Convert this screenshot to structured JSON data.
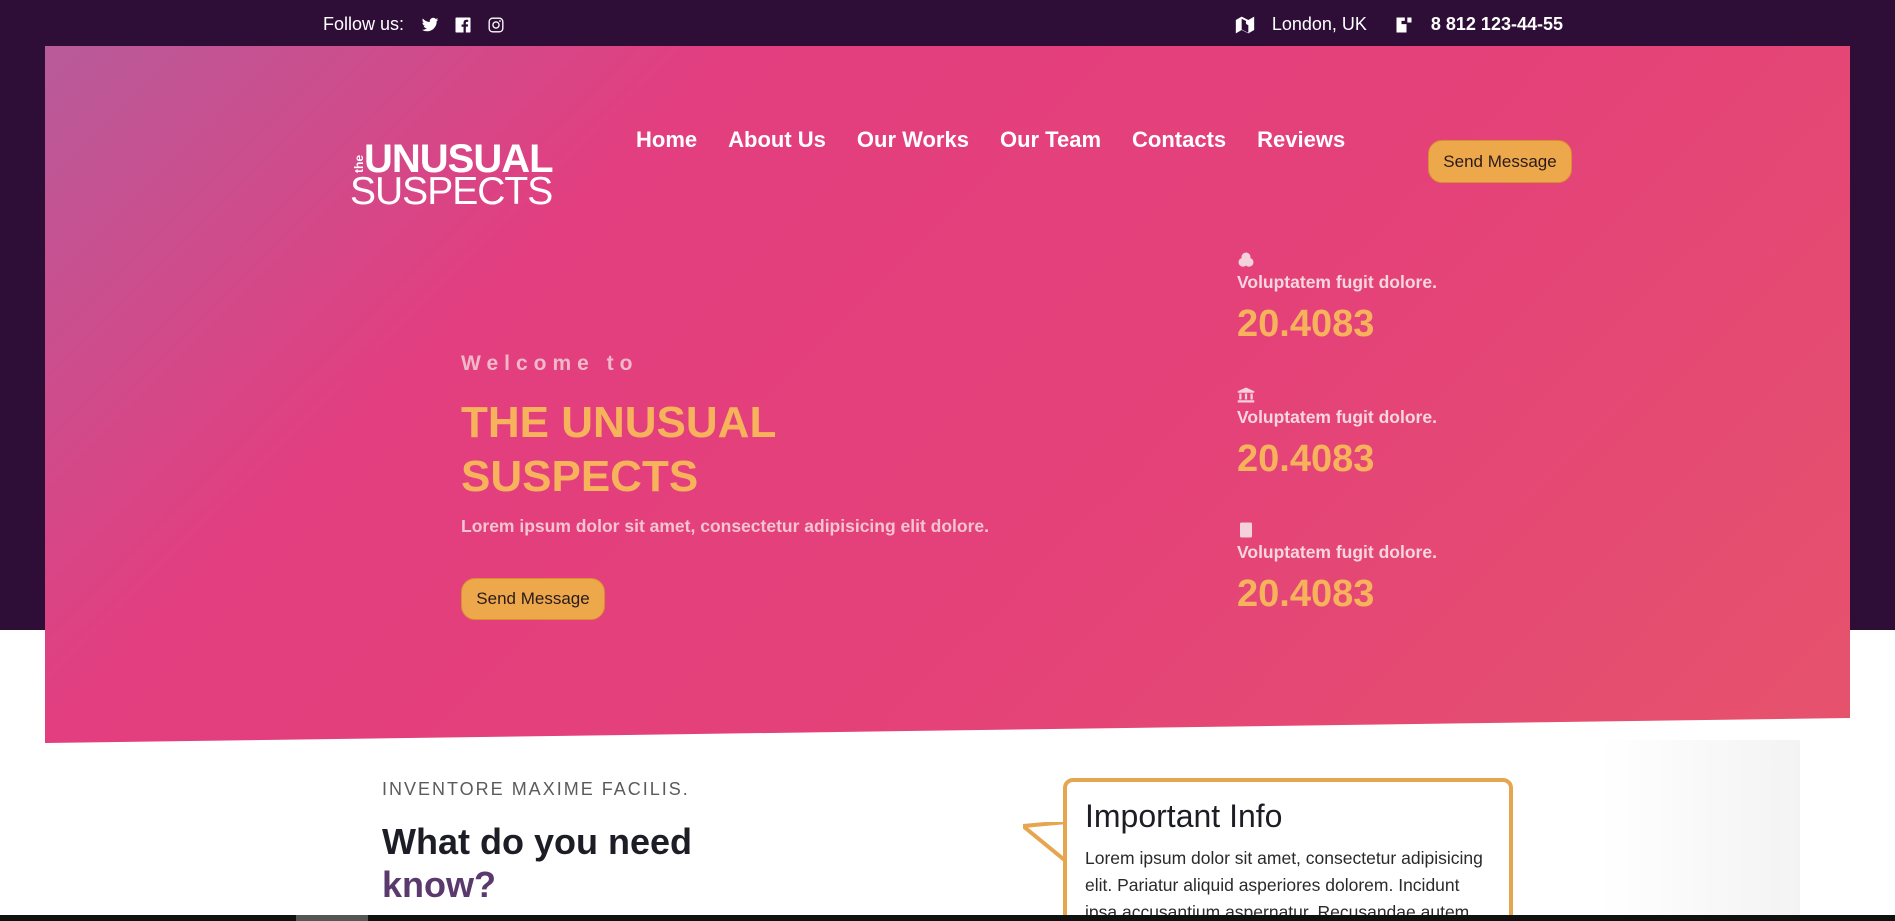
{
  "topbar": {
    "follow_label": "Follow us:",
    "social": [
      "twitter-icon",
      "facebook-icon",
      "instagram-icon"
    ],
    "location": "London, UK",
    "phone": "8 812 123-44-55"
  },
  "logo": {
    "the": "the",
    "line1": "UNUSUAL",
    "line2": "SUSPECTS"
  },
  "nav": {
    "items": [
      {
        "label": "Home"
      },
      {
        "label": "About Us"
      },
      {
        "label": "Our Works"
      },
      {
        "label": "Our Team"
      },
      {
        "label": "Contacts"
      },
      {
        "label": "Reviews"
      }
    ],
    "cta": "Send Message"
  },
  "hero": {
    "welcome": "Welcome to",
    "title": "THE UNUSUAL SUSPECTS",
    "subtitle": "Lorem ipsum dolor sit amet, consectetur adipisicing elit dolore.",
    "cta": "Send Message"
  },
  "stats": [
    {
      "icon": "coins-icon",
      "label": "Voluptatem fugit dolore.",
      "value": "20.4083"
    },
    {
      "icon": "bank-icon",
      "label": "Voluptatem fugit dolore.",
      "value": "20.4083"
    },
    {
      "icon": "book-icon",
      "label": "Voluptatem fugit dolore.",
      "value": "20.4083"
    }
  ],
  "section": {
    "eyebrow": "INVENTORE MAXIME FACILIS.",
    "heading_line1": "What do you need",
    "heading_line2": "know?"
  },
  "info": {
    "title": "Important Info",
    "body": "Lorem ipsum dolor sit amet, consectetur adipisicing elit. Pariatur aliquid asperiores dolorem. Incidunt ipsa accusantium aspernatur. Recusandae autem."
  },
  "colors": {
    "dark": "#2e0e37",
    "pink": "#e33e7f",
    "accent": "#f7b35c",
    "button": "#eda84c"
  }
}
